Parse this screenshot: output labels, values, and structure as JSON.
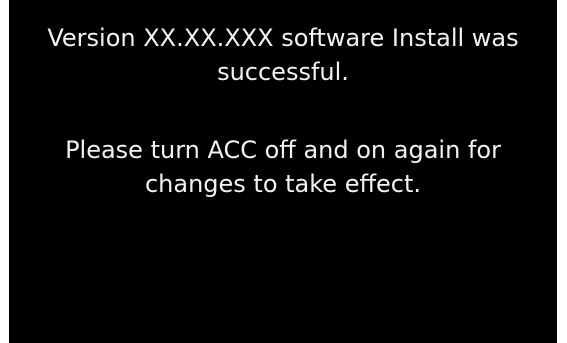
{
  "screen": {
    "background": "#000000",
    "text_color": "#f2f2f2",
    "message_install": {
      "line1": "Version XX.XX.XXX software Install was",
      "line2": "successful."
    },
    "message_restart": {
      "line1": "Please turn ACC off and on again for",
      "line2": "changes to take effect."
    }
  }
}
